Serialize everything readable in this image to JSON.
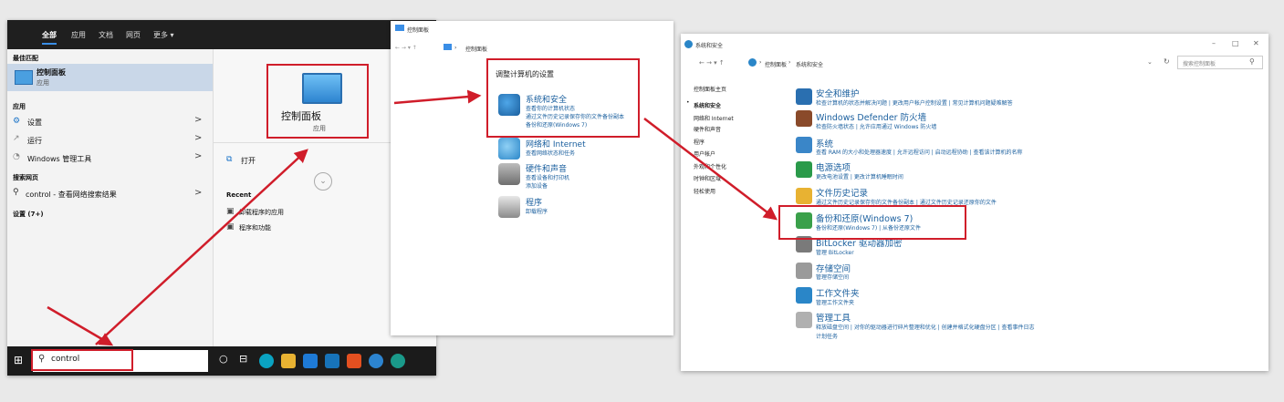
{
  "colors": {
    "accent_red": "#d01d2a",
    "link_blue": "#1a5f9e",
    "taskbar": "#1b1b1b"
  },
  "start_menu": {
    "tabs": [
      "全部",
      "应用",
      "文档",
      "网页",
      "更多 ▾"
    ],
    "best_match_header": "最佳匹配",
    "best_match": {
      "title": "控制面板",
      "subtitle": "应用"
    },
    "apps_header": "应用",
    "apps": [
      {
        "label": "设置",
        "arrow": ">"
      },
      {
        "label": "运行",
        "arrow": ">"
      },
      {
        "label": "Windows 管理工具",
        "arrow": ">"
      }
    ],
    "web_header": "搜索网页",
    "web_item": {
      "label": "control - 查看网络搜索结果",
      "arrow": ">"
    },
    "settings_header": "设置 (7+)",
    "preview": {
      "title": "控制面板",
      "subtitle": "应用"
    },
    "open_label": "打开",
    "recent_header": "Recent",
    "recent_items": [
      "卸载程序的应用",
      "程序和功能"
    ],
    "search_text": "control"
  },
  "control_panel": {
    "window_title": "控制面板",
    "window_buttons": [
      "–",
      "□",
      "✕"
    ],
    "nav": "← → ▾ ↑",
    "breadcrumb": "控制面板",
    "heading": "调整计算机的设置",
    "categories": [
      {
        "title": "系统和安全",
        "subs": [
          "查看你的计算机状态",
          "通过文件历史记录保存你的文件备份副本",
          "备份和还原(Windows 7)"
        ]
      },
      {
        "title": "网络和 Internet",
        "subs": [
          "查看网络状态和任务"
        ]
      },
      {
        "title": "硬件和声音",
        "subs": [
          "查看设备和打印机",
          "添加设备"
        ]
      },
      {
        "title": "程序",
        "subs": [
          "卸载程序"
        ]
      }
    ]
  },
  "security": {
    "window_title": "系统和安全",
    "window_buttons": [
      "–",
      "□",
      "✕"
    ],
    "nav": "← → ▾ ↑",
    "breadcrumb": [
      "控制面板",
      "系统和安全"
    ],
    "search_placeholder": "搜索控制面板",
    "left_nav": [
      "控制面板主页",
      "系统和安全",
      "网络和 Internet",
      "硬件和声音",
      "程序",
      "用户帐户",
      "外观和个性化",
      "时钟和区域",
      "轻松使用"
    ],
    "sections": [
      {
        "title": "安全和维护",
        "links": "检查计算机的状态并解决问题  |  更改用户帐户控制设置  |  常见计算机问题疑难解答"
      },
      {
        "title": "Windows Defender 防火墙",
        "links": "检查防火墙状态  |  允许应用通过 Windows 防火墙"
      },
      {
        "title": "系统",
        "links": "查看 RAM 的大小和处理器速度  |  允许远程访问  |  启动远程协助  |  查看该计算机的名称"
      },
      {
        "title": "电源选项",
        "links": "更改电池设置  |  更改计算机睡眠时间"
      },
      {
        "title": "文件历史记录",
        "links": "通过文件历史记录保存你的文件备份副本  |  通过文件历史记录还原你的文件"
      },
      {
        "title": "备份和还原(Windows 7)",
        "links": "备份和还原(Windows 7)  |  从备份还原文件"
      },
      {
        "title": "BitLocker 驱动器加密",
        "links": "管理 BitLocker"
      },
      {
        "title": "存储空间",
        "links": "管理存储空间"
      },
      {
        "title": "工作文件夹",
        "links": "管理工作文件夹"
      },
      {
        "title": "管理工具",
        "links": "释放磁盘空间  |  对你的驱动器进行碎片整理和优化  |  创建并格式化硬盘分区  |  查看事件日志",
        "links2": "计划任务"
      }
    ]
  }
}
